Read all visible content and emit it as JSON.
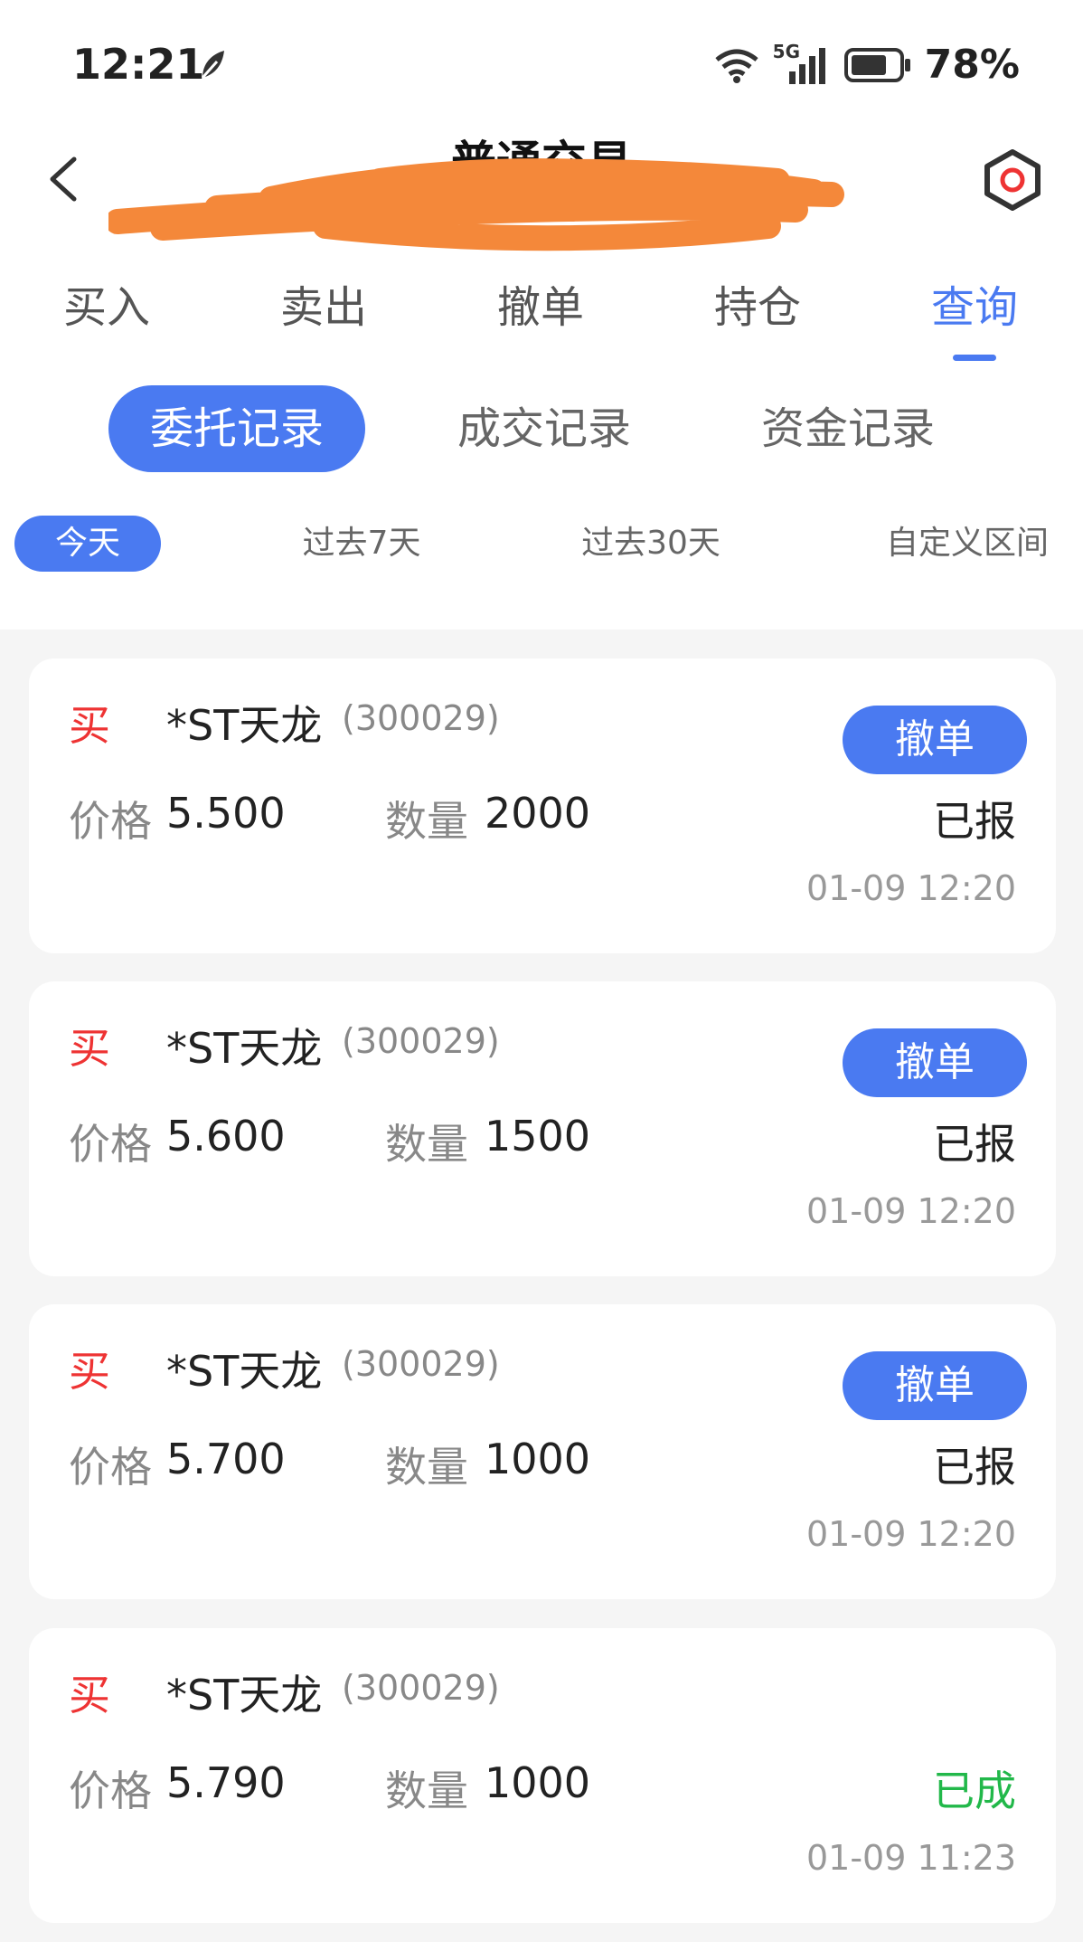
{
  "status_bar": {
    "time": "12:21",
    "network": "5G",
    "battery": "78%"
  },
  "header": {
    "title": "普通交易"
  },
  "main_tabs": [
    {
      "label": "买入",
      "active": false
    },
    {
      "label": "卖出",
      "active": false
    },
    {
      "label": "撤单",
      "active": false
    },
    {
      "label": "持仓",
      "active": false
    },
    {
      "label": "查询",
      "active": true
    }
  ],
  "sub_tabs": [
    {
      "label": "委托记录",
      "active": true
    },
    {
      "label": "成交记录",
      "active": false
    },
    {
      "label": "资金记录",
      "active": false
    }
  ],
  "range_tabs": [
    {
      "label": "今天",
      "active": true
    },
    {
      "label": "过去7天",
      "active": false
    },
    {
      "label": "过去30天",
      "active": false
    },
    {
      "label": "自定义区间",
      "active": false
    }
  ],
  "labels": {
    "price": "价格",
    "quantity": "数量",
    "cancel": "撤单"
  },
  "orders": [
    {
      "side": "买",
      "name": "*ST天龙",
      "code": "(300029)",
      "price": "5.500",
      "quantity": "2000",
      "status": "已报",
      "datetime": "01-09 12:20",
      "cancelable": true
    },
    {
      "side": "买",
      "name": "*ST天龙",
      "code": "(300029)",
      "price": "5.600",
      "quantity": "1500",
      "status": "已报",
      "datetime": "01-09 12:20",
      "cancelable": true
    },
    {
      "side": "买",
      "name": "*ST天龙",
      "code": "(300029)",
      "price": "5.700",
      "quantity": "1000",
      "status": "已报",
      "datetime": "01-09 12:20",
      "cancelable": true
    },
    {
      "side": "买",
      "name": "*ST天龙",
      "code": "(300029)",
      "price": "5.790",
      "quantity": "1000",
      "status": "已成",
      "datetime": "01-09 11:23",
      "cancelable": false
    }
  ],
  "colors": {
    "accent": "#4a7af1",
    "buy": "#e33333",
    "filled": "#22b84a"
  }
}
